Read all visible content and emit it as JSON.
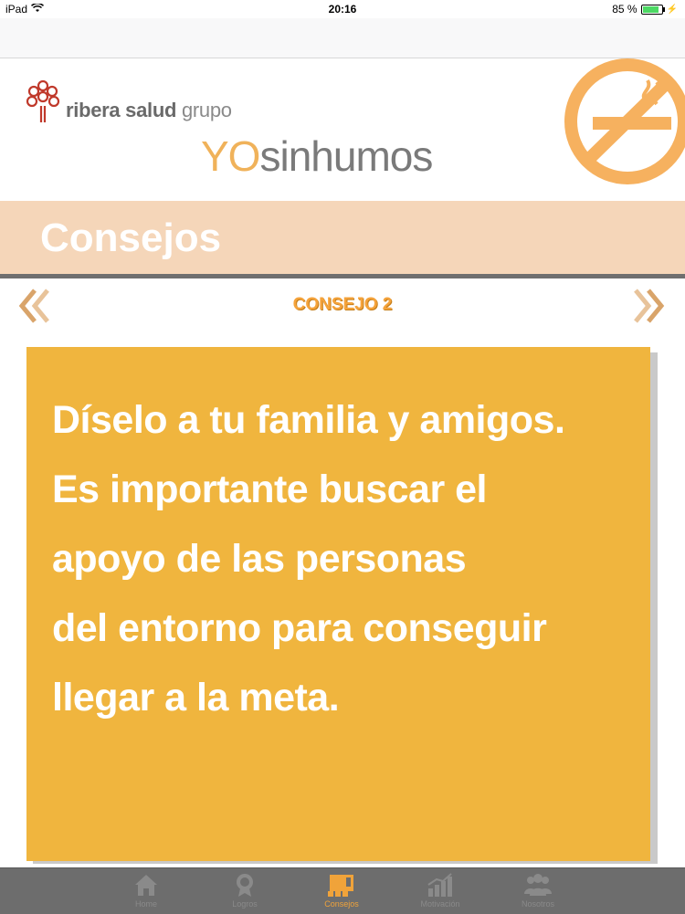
{
  "status_bar": {
    "device": "iPad",
    "time": "20:16",
    "battery": "85 %"
  },
  "brand": {
    "name_bold": "ribera salud",
    "name_light": "grupo"
  },
  "app_title": {
    "yo": "YO",
    "sin": "sin",
    "humos": "humos"
  },
  "section": {
    "title": "Consejos"
  },
  "pager": {
    "title": "CONSEJO 2"
  },
  "tip": {
    "lines": [
      "Díselo a tu familia y amigos.",
      "Es importante buscar el",
      "apoyo de las personas",
      "del entorno para conseguir",
      "llegar a la meta."
    ]
  },
  "tabs": [
    {
      "label": "Home",
      "icon": "home-icon",
      "active": false
    },
    {
      "label": "Logros",
      "icon": "medal-icon",
      "active": false
    },
    {
      "label": "Consejos",
      "icon": "advice-icon",
      "active": true
    },
    {
      "label": "Motivación",
      "icon": "chart-icon",
      "active": false
    },
    {
      "label": "Nosotros",
      "icon": "people-icon",
      "active": false
    }
  ],
  "colors": {
    "accent_orange": "#f0b53e",
    "band_peach": "#f5d6b9",
    "tab_bar": "#6d6d6d",
    "active_tab": "#f0a33a"
  }
}
